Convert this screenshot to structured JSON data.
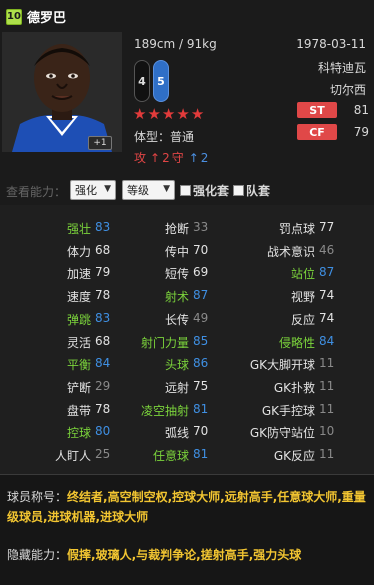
{
  "player": {
    "rating": "10",
    "name": "德罗巴",
    "height_weight": "189cm / 91kg",
    "birthdate": "1978-03-11",
    "club_line1": "科特迪瓦",
    "club_line2": "切尔西",
    "plus_badge": "+1",
    "weak_foot_left": "4",
    "weak_foot_right": "5",
    "stars": 5,
    "body_type_label": "体型：",
    "body_type_value": "普通",
    "attack_label": "攻",
    "attack_arrow": "↑",
    "attack_value": "2",
    "defense_label": "守",
    "defense_arrow": "↑",
    "defense_value": "2",
    "positions": [
      {
        "pos": "ST",
        "value": "81"
      },
      {
        "pos": "CF",
        "value": "79"
      }
    ]
  },
  "controls": {
    "label": "查看能力：",
    "select1": "强化",
    "select2": "等级",
    "check1": "强化套",
    "check2": "队套"
  },
  "stats": [
    [
      {
        "label": "强壮",
        "value": "83",
        "lc": "green",
        "vc": "blue"
      },
      {
        "label": "抢断",
        "value": "33",
        "lc": "white",
        "vc": "gray"
      },
      {
        "label": "罚点球",
        "value": "77",
        "lc": "white",
        "vc": "white"
      }
    ],
    [
      {
        "label": "体力",
        "value": "68",
        "lc": "white",
        "vc": "white"
      },
      {
        "label": "传中",
        "value": "70",
        "lc": "white",
        "vc": "white"
      },
      {
        "label": "战术意识",
        "value": "46",
        "lc": "white",
        "vc": "gray"
      }
    ],
    [
      {
        "label": "加速",
        "value": "79",
        "lc": "white",
        "vc": "white"
      },
      {
        "label": "短传",
        "value": "69",
        "lc": "white",
        "vc": "white"
      },
      {
        "label": "站位",
        "value": "87",
        "lc": "green",
        "vc": "blue"
      }
    ],
    [
      {
        "label": "速度",
        "value": "78",
        "lc": "white",
        "vc": "white"
      },
      {
        "label": "射术",
        "value": "87",
        "lc": "green",
        "vc": "blue"
      },
      {
        "label": "视野",
        "value": "74",
        "lc": "white",
        "vc": "white"
      }
    ],
    [
      {
        "label": "弹跳",
        "value": "83",
        "lc": "green",
        "vc": "blue"
      },
      {
        "label": "长传",
        "value": "49",
        "lc": "white",
        "vc": "gray"
      },
      {
        "label": "反应",
        "value": "74",
        "lc": "white",
        "vc": "white"
      }
    ],
    [
      {
        "label": "灵活",
        "value": "68",
        "lc": "white",
        "vc": "white"
      },
      {
        "label": "射门力量",
        "value": "85",
        "lc": "green",
        "vc": "blue"
      },
      {
        "label": "侵略性",
        "value": "84",
        "lc": "green",
        "vc": "blue"
      }
    ],
    [
      {
        "label": "平衡",
        "value": "84",
        "lc": "green",
        "vc": "blue"
      },
      {
        "label": "头球",
        "value": "86",
        "lc": "green",
        "vc": "blue"
      },
      {
        "label": "GK大脚开球",
        "value": "11",
        "lc": "white",
        "vc": "gray"
      }
    ],
    [
      {
        "label": "铲断",
        "value": "29",
        "lc": "white",
        "vc": "gray"
      },
      {
        "label": "远射",
        "value": "75",
        "lc": "white",
        "vc": "white"
      },
      {
        "label": "GK扑救",
        "value": "11",
        "lc": "white",
        "vc": "gray"
      }
    ],
    [
      {
        "label": "盘带",
        "value": "78",
        "lc": "white",
        "vc": "white"
      },
      {
        "label": "凌空抽射",
        "value": "81",
        "lc": "green",
        "vc": "blue"
      },
      {
        "label": "GK手控球",
        "value": "11",
        "lc": "white",
        "vc": "gray"
      }
    ],
    [
      {
        "label": "控球",
        "value": "80",
        "lc": "green",
        "vc": "blue"
      },
      {
        "label": "弧线",
        "value": "70",
        "lc": "white",
        "vc": "white"
      },
      {
        "label": "GK防守站位",
        "value": "10",
        "lc": "white",
        "vc": "gray"
      }
    ],
    [
      {
        "label": "人盯人",
        "value": "25",
        "lc": "white",
        "vc": "gray"
      },
      {
        "label": "任意球",
        "value": "81",
        "lc": "green",
        "vc": "blue"
      },
      {
        "label": "GK反应",
        "value": "11",
        "lc": "white",
        "vc": "gray"
      }
    ]
  ],
  "footer": {
    "title_label": "球员称号：",
    "title_value": "终结者,高空制空权,控球大师,远射高手,任意球大师,重量级球员,进球机器,进球大师",
    "hidden_label": "隐藏能力：",
    "hidden_value": "假摔,玻璃人,与裁判争论,搓射高手,强力头球"
  },
  "colors": {
    "green": "#7bd33b",
    "blue": "#3f8fe2",
    "red": "#e04848",
    "yellow": "#f2c531"
  }
}
